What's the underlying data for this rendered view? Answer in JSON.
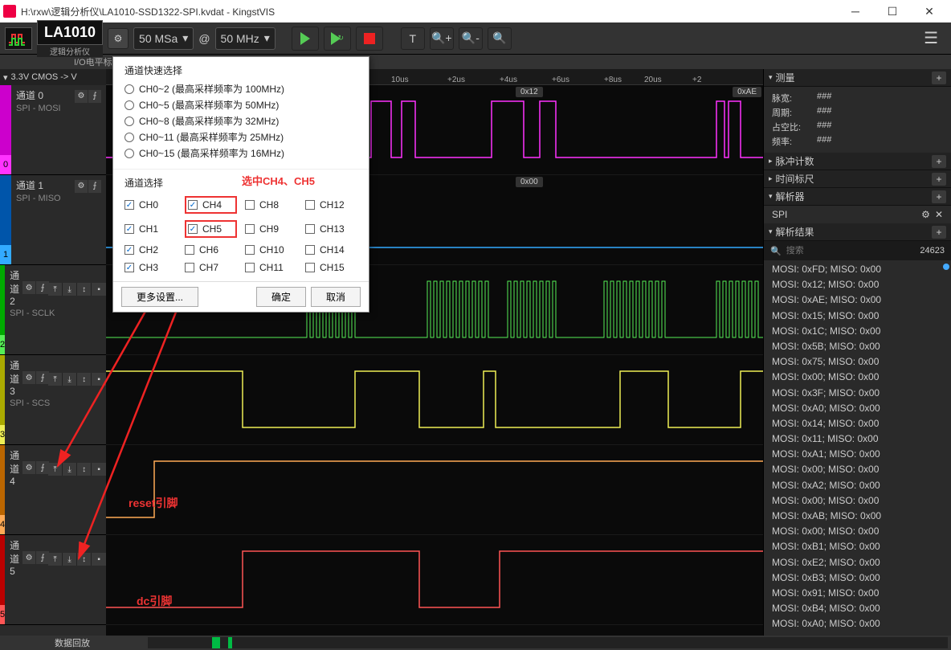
{
  "titlebar": {
    "path": "H:\\rxw\\逻辑分析仪\\LA1010-SSD1322-SPI.kvdat - KingstVIS"
  },
  "toolbar": {
    "device": "LA1010",
    "device_sub": "逻辑分析仪",
    "samples": "50 MSa",
    "at": "@",
    "rate": "50 MHz",
    "io_std": "I/O电平标准"
  },
  "voltage": "3.3V CMOS  -> V",
  "channels": [
    {
      "idx": "0",
      "name": "通道 0",
      "proto": "SPI - MOSI",
      "color_top": "#c0c",
      "color_bot": "#f3f",
      "edge": false
    },
    {
      "idx": "1",
      "name": "通道 1",
      "proto": "SPI - MISO",
      "color_top": "#05a",
      "color_bot": "#3af",
      "edge": false
    },
    {
      "idx": "2",
      "name": "通道 2",
      "proto": "SPI - SCLK",
      "color_top": "#0a0",
      "color_bot": "#5e5",
      "edge": true
    },
    {
      "idx": "3",
      "name": "通道 3",
      "proto": "SPI - SCS",
      "color_top": "#aa0",
      "color_bot": "#ee5",
      "edge": true
    },
    {
      "idx": "4",
      "name": "通道 4",
      "proto": "",
      "color_top": "#b60",
      "color_bot": "#fa5",
      "edge": true
    },
    {
      "idx": "5",
      "name": "通道 5",
      "proto": "",
      "color_top": "#b00",
      "color_bot": "#f55",
      "edge": true
    }
  ],
  "ruler_ticks": [
    "+4us",
    "+6us",
    "+8us",
    "10us",
    "+2us",
    "+4us",
    "+6us",
    "+8us",
    "20us",
    "+2"
  ],
  "wave_labels": {
    "ch0": "0x12",
    "ch0b": "0xAE",
    "ch1": "0x00"
  },
  "dialog": {
    "quick_title": "通道快速选择",
    "radios": [
      "CH0~2 (最高采样频率为 100MHz)",
      "CH0~5 (最高采样频率为 50MHz)",
      "CH0~8 (最高采样频率为 32MHz)",
      "CH0~11 (最高采样频率为 25MHz)",
      "CH0~15 (最高采样频率为 16MHz)"
    ],
    "sel_title": "通道选择",
    "annot": "选中CH4、CH5",
    "ch_cols": [
      [
        {
          "l": "CH0",
          "c": true
        },
        {
          "l": "CH1",
          "c": true
        },
        {
          "l": "CH2",
          "c": true
        },
        {
          "l": "CH3",
          "c": true
        }
      ],
      [
        {
          "l": "CH4",
          "c": true
        },
        {
          "l": "CH5",
          "c": true
        },
        {
          "l": "CH6",
          "c": false
        },
        {
          "l": "CH7",
          "c": false
        }
      ],
      [
        {
          "l": "CH8",
          "c": false
        },
        {
          "l": "CH9",
          "c": false
        },
        {
          "l": "CH10",
          "c": false
        },
        {
          "l": "CH11",
          "c": false
        }
      ],
      [
        {
          "l": "CH12",
          "c": false
        },
        {
          "l": "CH13",
          "c": false
        },
        {
          "l": "CH14",
          "c": false
        },
        {
          "l": "CH15",
          "c": false
        }
      ]
    ],
    "more": "更多设置...",
    "ok": "确定",
    "cancel": "取消"
  },
  "annotations": {
    "reset": "reset引脚",
    "dc": "dc引脚"
  },
  "panels": {
    "measure": "测量",
    "measure_rows": [
      {
        "l": "脉宽:",
        "v": "###"
      },
      {
        "l": "周期:",
        "v": "###"
      },
      {
        "l": "占空比:",
        "v": "###"
      },
      {
        "l": "频率:",
        "v": "###"
      }
    ],
    "pulse": "脉冲计数",
    "timeruler": "时间标尺",
    "parser": "解析器",
    "parser_name": "SPI",
    "results": "解析结果",
    "search_ph": "搜索",
    "count": "24623",
    "lines": [
      "MOSI: 0xFD;  MISO: 0x00",
      "MOSI: 0x12;  MISO: 0x00",
      "MOSI: 0xAE;  MISO: 0x00",
      "MOSI: 0x15;  MISO: 0x00",
      "MOSI: 0x1C;  MISO: 0x00",
      "MOSI: 0x5B;  MISO: 0x00",
      "MOSI: 0x75;  MISO: 0x00",
      "MOSI: 0x00;  MISO: 0x00",
      "MOSI: 0x3F;  MISO: 0x00",
      "MOSI: 0xA0;  MISO: 0x00",
      "MOSI: 0x14;  MISO: 0x00",
      "MOSI: 0x11;  MISO: 0x00",
      "MOSI: 0xA1;  MISO: 0x00",
      "MOSI: 0x00;  MISO: 0x00",
      "MOSI: 0xA2;  MISO: 0x00",
      "MOSI: 0x00;  MISO: 0x00",
      "MOSI: 0xAB;  MISO: 0x00",
      "MOSI: 0x00;  MISO: 0x00",
      "MOSI: 0xB1;  MISO: 0x00",
      "MOSI: 0xE2;  MISO: 0x00",
      "MOSI: 0xB3;  MISO: 0x00",
      "MOSI: 0x91;  MISO: 0x00",
      "MOSI: 0xB4;  MISO: 0x00",
      "MOSI: 0xA0;  MISO: 0x00"
    ]
  },
  "bottom": "数据回放"
}
